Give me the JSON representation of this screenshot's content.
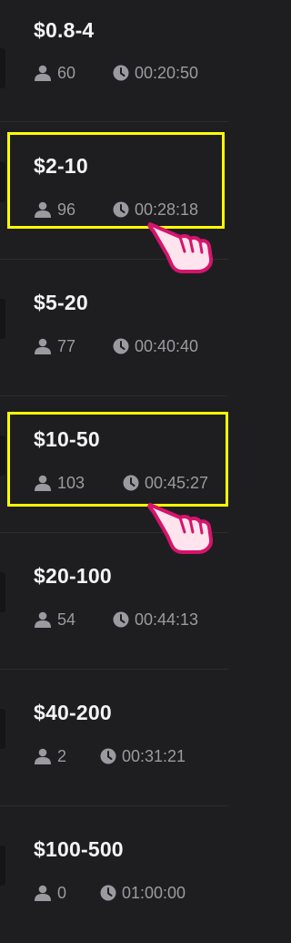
{
  "tables": [
    {
      "stake": "$0.8-4",
      "players": "60",
      "time": "00:20:50"
    },
    {
      "stake": "$2-10",
      "players": "96",
      "time": "00:28:18"
    },
    {
      "stake": "$5-20",
      "players": "77",
      "time": "00:40:40"
    },
    {
      "stake": "$10-50",
      "players": "103",
      "time": "00:45:27"
    },
    {
      "stake": "$20-100",
      "players": "54",
      "time": "00:44:13"
    },
    {
      "stake": "$40-200",
      "players": "2",
      "time": "00:31:21"
    },
    {
      "stake": "$100-500",
      "players": "0",
      "time": "01:00:00"
    }
  ],
  "icons": {
    "players": "person-icon",
    "time": "clock-icon",
    "pointer": "pointing-hand-icon"
  },
  "colors": {
    "background": "#1e1e21",
    "highlight": "#ffff00",
    "hand_outline": "#d6146c",
    "hand_fill": "#ffe4ee"
  }
}
